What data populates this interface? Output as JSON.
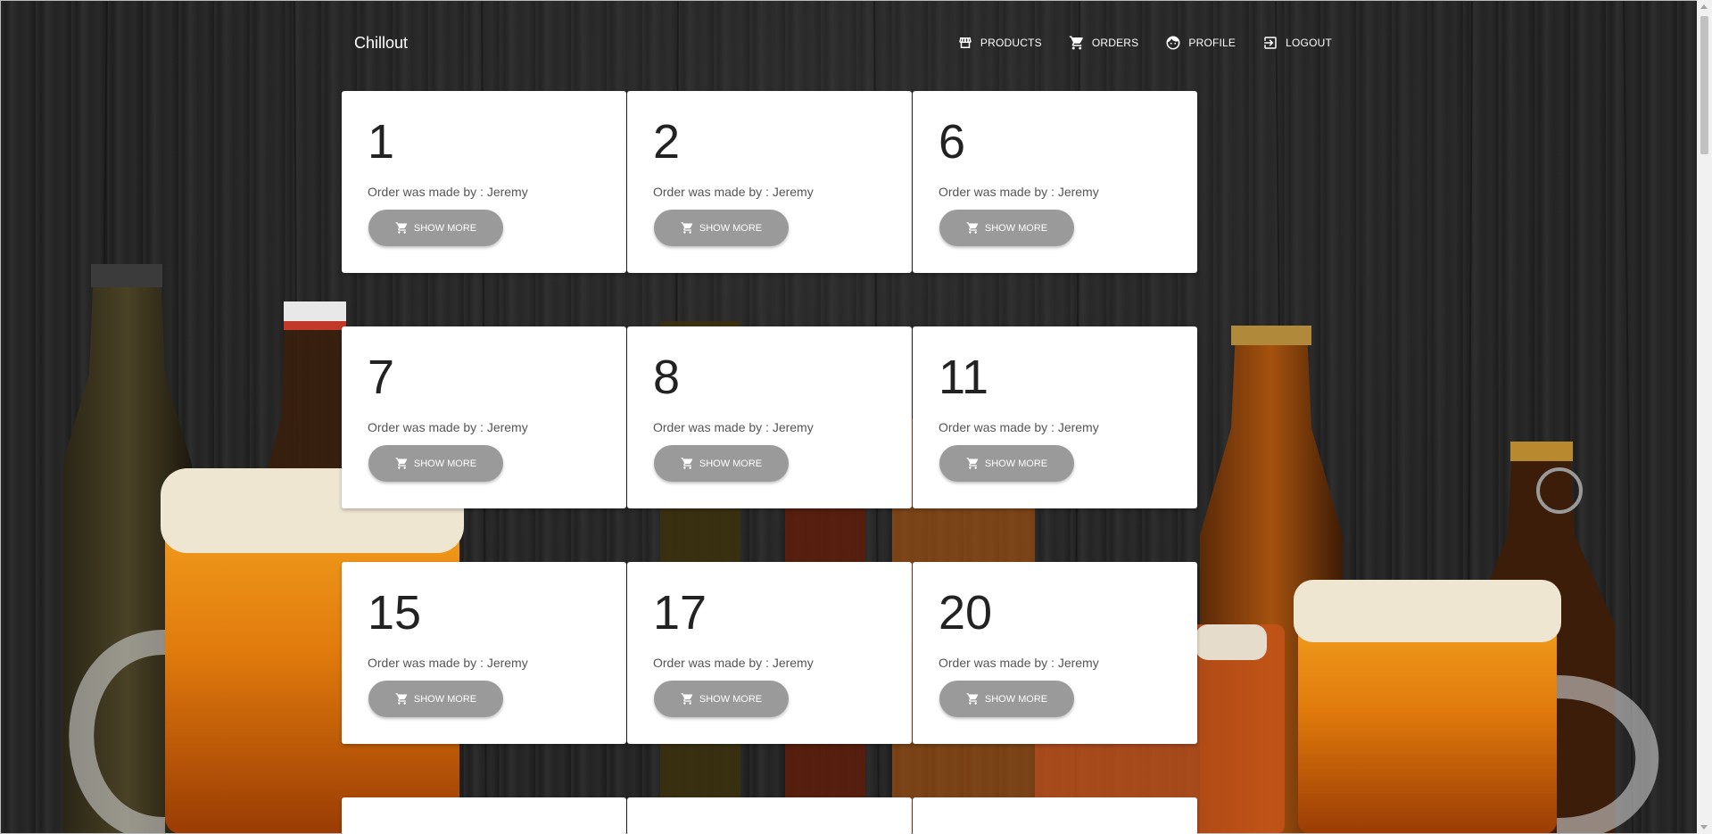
{
  "brand": "Chillout",
  "nav": [
    {
      "label": "PRODUCTS",
      "icon": "store-icon"
    },
    {
      "label": "ORDERS",
      "icon": "cart-icon"
    },
    {
      "label": "PROFILE",
      "icon": "face-icon"
    },
    {
      "label": "LOGOUT",
      "icon": "logout-icon"
    }
  ],
  "orders": [
    {
      "id": "1",
      "made_by": "Order was made by : Jeremy",
      "button": "SHOW MORE"
    },
    {
      "id": "2",
      "made_by": "Order was made by : Jeremy",
      "button": "SHOW MORE"
    },
    {
      "id": "6",
      "made_by": "Order was made by : Jeremy",
      "button": "SHOW MORE"
    },
    {
      "id": "7",
      "made_by": "Order was made by : Jeremy",
      "button": "SHOW MORE"
    },
    {
      "id": "8",
      "made_by": "Order was made by : Jeremy",
      "button": "SHOW MORE"
    },
    {
      "id": "11",
      "made_by": "Order was made by : Jeremy",
      "button": "SHOW MORE"
    },
    {
      "id": "15",
      "made_by": "Order was made by : Jeremy",
      "button": "SHOW MORE"
    },
    {
      "id": "17",
      "made_by": "Order was made by : Jeremy",
      "button": "SHOW MORE"
    },
    {
      "id": "20",
      "made_by": "Order was made by : Jeremy",
      "button": "SHOW MORE"
    }
  ],
  "colors": {
    "button_bg": "#9a9a9a",
    "card_bg": "#ffffff",
    "background": "#222222"
  }
}
